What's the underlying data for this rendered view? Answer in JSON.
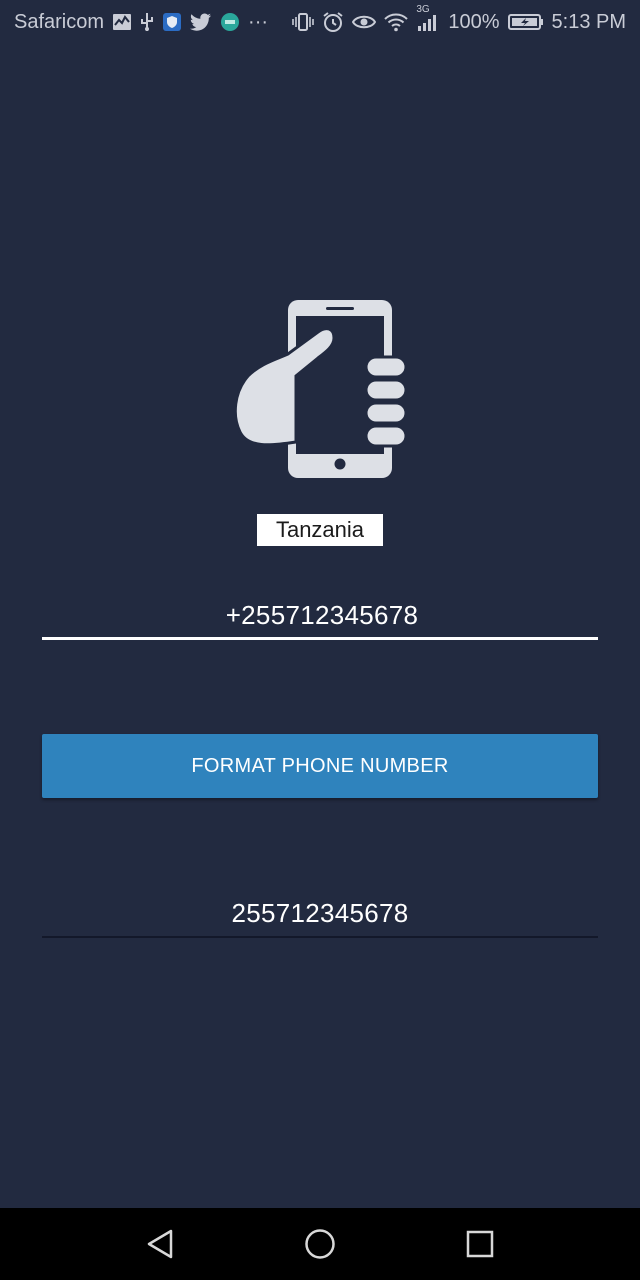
{
  "status_bar": {
    "carrier": "Safaricom",
    "battery_percent": "100%",
    "time": "5:13 PM",
    "network_type": "3G",
    "overflow": "···",
    "icons": [
      "activity-icon",
      "usb-icon",
      "shield-icon",
      "twitter-icon",
      "app-badge-icon",
      "vibrate-icon",
      "alarm-icon",
      "eye-icon",
      "wifi-icon",
      "signal-icon",
      "battery-charging-icon"
    ]
  },
  "main": {
    "hero_icon": "hand-holding-phone-icon",
    "country_label": "Tanzania",
    "phone_input": {
      "value": "+255712345678"
    },
    "format_button_label": "FORMAT PHONE NUMBER",
    "result_value": "255712345678"
  },
  "nav_bar": {
    "icons": [
      "back-icon",
      "home-icon",
      "recents-icon"
    ]
  },
  "colors": {
    "background": "#222a40",
    "button": "#2f83bd",
    "hero_icon": "#dde0e6"
  }
}
